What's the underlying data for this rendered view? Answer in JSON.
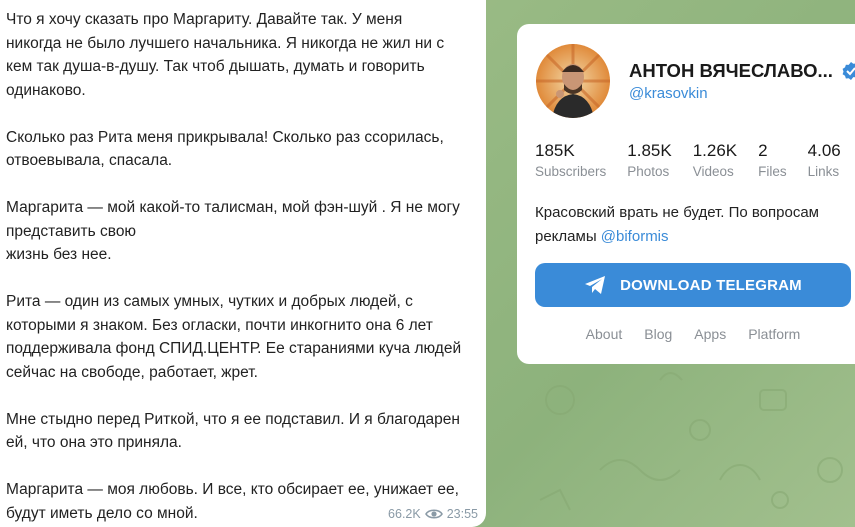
{
  "message": {
    "text": "Что я хочу сказать про Маргариту. Давайте так. У меня\nникогда не было лучшего начальника. Я никогда не жил ни с\nкем так душа-в-душу. Так чтоб дышать, думать и говорить\nодинаково.\n\nСколько раз Рита меня прикрывала! Сколько раз ссорилась,\nотвоевывала, спасала.\n\nМаргарита — мой какой-то талисман, мой фэн-шуй . Я не могу\nпредставить свою\nжизнь без нее.\n\nРита — один из самых умных, чутких и добрых людей, с\nкоторыми я знаком. Без огласки, почти инкогнито она 6 лет\nподдерживала фонд СПИД.ЦЕНТР. Ее стараниями куча людей\nсейчас на свободе, работает, жрет.\n\nМне стыдно перед Риткой, что я ее подставил. И я благодарен\nей, что она это приняла.\n\nМаргарита — моя любовь. И все, кто обсирает ее, унижает ее,\nбудут иметь дело со мной.",
    "views": "66.2K",
    "time": "23:55",
    "views_icon": "eye-icon"
  },
  "channel": {
    "title": "АНТОН ВЯЧЕСЛАВО...",
    "username": "@krasovkin",
    "verified_icon": "verified-badge-icon",
    "stats": [
      {
        "value": "185K",
        "label": "Subscribers"
      },
      {
        "value": "1.85K",
        "label": "Photos"
      },
      {
        "value": "1.26K",
        "label": "Videos"
      },
      {
        "value": "2",
        "label": "Files"
      },
      {
        "value": "4.06",
        "label": "Links"
      }
    ],
    "description_text": "Красовский врать не будет. По вопросам рекламы ",
    "description_mention": "@biformis",
    "download_label": "DOWNLOAD TELEGRAM",
    "download_icon": "telegram-plane-icon",
    "links": [
      "About",
      "Blog",
      "Apps",
      "Platform"
    ]
  },
  "colors": {
    "accent": "#3a8bd8",
    "background": "#9fbf8a"
  }
}
